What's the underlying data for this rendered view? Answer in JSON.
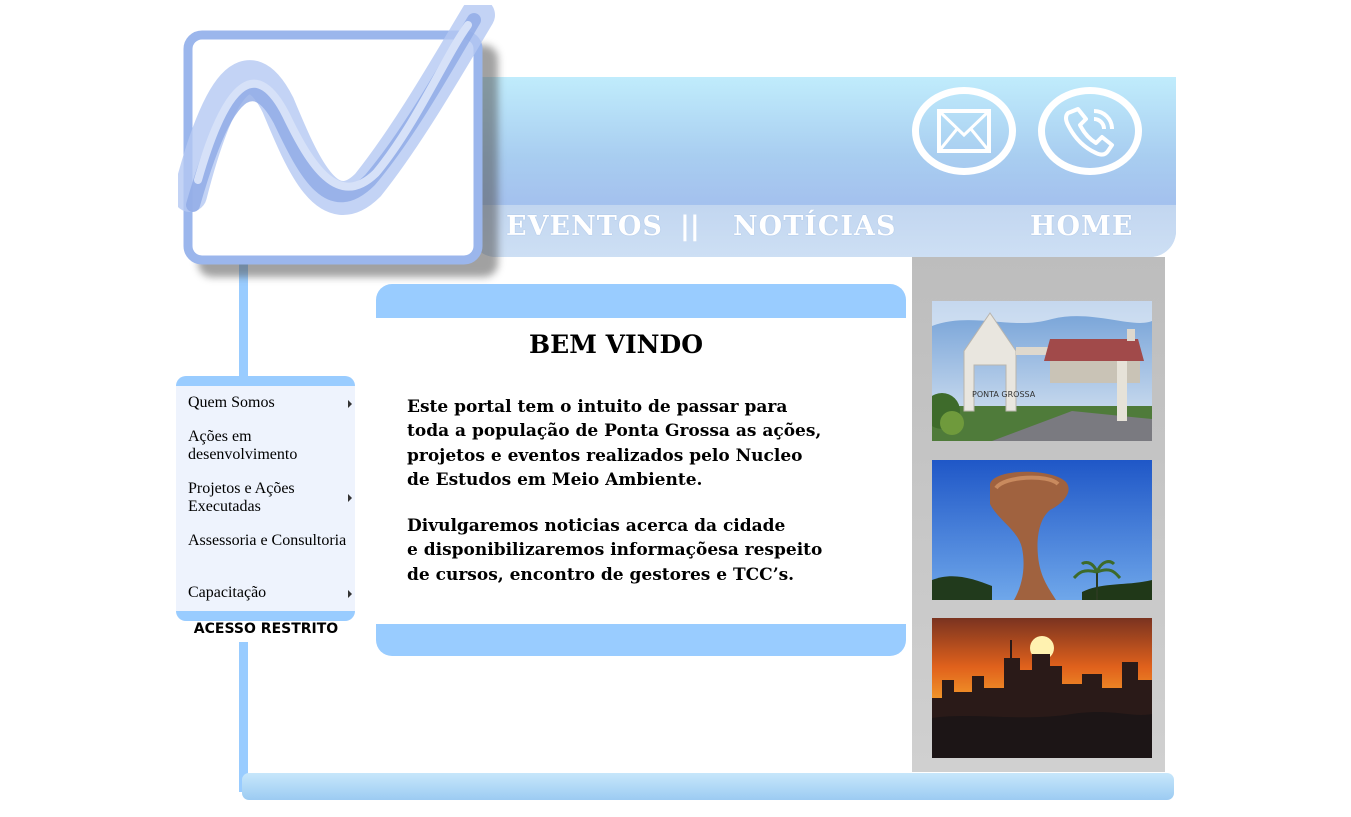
{
  "header": {
    "nav": {
      "eventos": "EVENTOS",
      "separator": "||",
      "noticias": "NOTÍCIAS",
      "home": "HOME"
    },
    "icons": [
      "envelope-icon",
      "phone-icon"
    ]
  },
  "menu": {
    "items": [
      {
        "label": "Quem Somos",
        "has_submenu": true
      },
      {
        "label": "Ações em desenvolvimento",
        "has_submenu": false
      },
      {
        "label": "Projetos e Ações Executadas",
        "has_submenu": true
      },
      {
        "label": "Assessoria e Consultoria",
        "has_submenu": false
      },
      {
        "label": "Capacitação",
        "has_submenu": true
      }
    ],
    "restricted": "ACESSO RESTRITO"
  },
  "content": {
    "title": "BEM VINDO",
    "paragraph1": "    Este portal tem o intuito de passar para\ntoda a população de Ponta Grossa as ações,\nprojetos e eventos realizados pelo Nucleo\nde Estudos em Meio Ambiente.",
    "paragraph2": "    Divulgaremos noticias acerca da cidade\ne disponibilizaremos informaçõesa respeito\nde cursos, encontro de gestores e TCC’s.",
    "portal_sign": "PONTA GROSSA"
  },
  "colors": {
    "accent": "#99ccff",
    "menu_bg": "#eef3fd",
    "photo_column": "#c4c4c4"
  }
}
